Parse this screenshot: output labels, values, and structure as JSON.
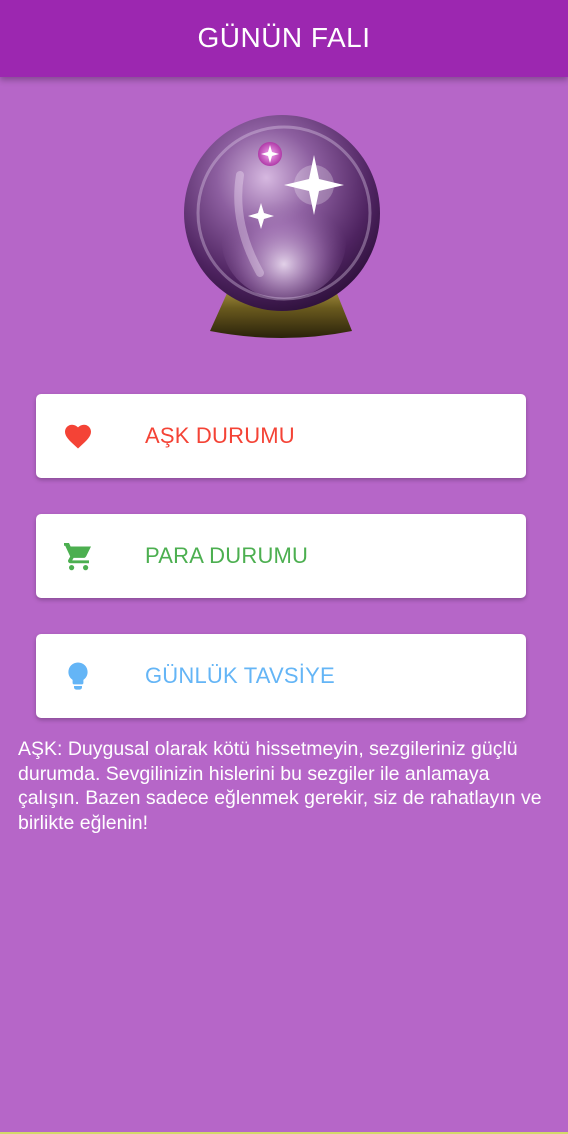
{
  "app_bar": {
    "title": "GÜNÜN FALI"
  },
  "hero": {
    "icon": "crystal-ball-icon"
  },
  "cards": [
    {
      "id": "love",
      "label": "AŞK DURUMU",
      "icon": "heart-icon",
      "color": "#f44336"
    },
    {
      "id": "money",
      "label": "PARA DURUMU",
      "icon": "shopping-cart-icon",
      "color": "#4caf50"
    },
    {
      "id": "advice",
      "label": "GÜNLÜK TAVSİYE",
      "icon": "lightbulb-icon",
      "color": "#64b5f6"
    }
  ],
  "fortune": {
    "text": "AŞK: Duygusal olarak kötü hissetmeyin, sezgileriniz güçlü durumda. Sevgilinizin hislerini bu sezgiler ile anlamaya çalışın. Bazen sadece eğlenmek gerekir, siz de rahatlayın ve birlikte eğlenin!"
  },
  "colors": {
    "background": "#b666c8",
    "app_bar": "#9c27b0",
    "card_background": "#ffffff",
    "text_light": "#ffffff"
  }
}
